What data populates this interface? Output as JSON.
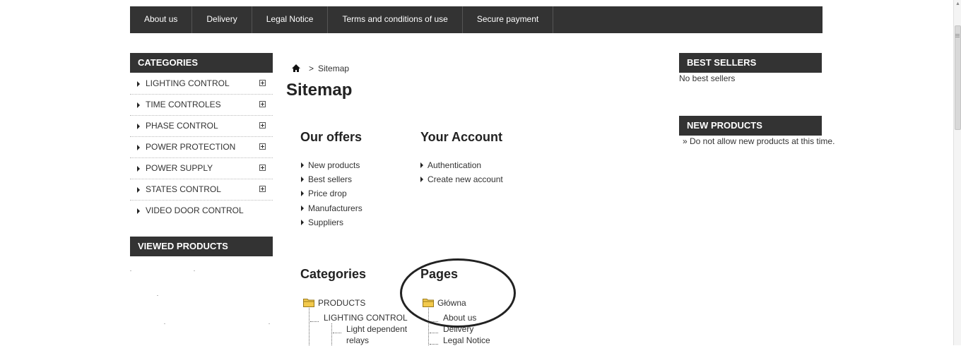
{
  "topnav": {
    "items": [
      "About us",
      "Delivery",
      "Legal Notice",
      "Terms and conditions of use",
      "Secure payment"
    ]
  },
  "left": {
    "categories_title": "CATEGORIES",
    "categories": [
      {
        "label": "LIGHTING CONTROL",
        "expandable": true
      },
      {
        "label": "TIME CONTROLES",
        "expandable": true
      },
      {
        "label": "PHASE CONTROL",
        "expandable": true
      },
      {
        "label": "POWER PROTECTION",
        "expandable": true
      },
      {
        "label": "POWER SUPPLY",
        "expandable": true
      },
      {
        "label": "STATES CONTROL",
        "expandable": true
      },
      {
        "label": "VIDEO DOOR CONTROL",
        "expandable": false
      }
    ],
    "viewed_title": "VIEWED PRODUCTS"
  },
  "breadcrumb": {
    "separator": ">",
    "current": "Sitemap"
  },
  "page_title": "Sitemap",
  "our_offers": {
    "title": "Our offers",
    "links": [
      "New products",
      "Best sellers",
      "Price drop",
      "Manufacturers",
      "Suppliers"
    ]
  },
  "your_account": {
    "title": "Your Account",
    "links": [
      "Authentication",
      "Create new account"
    ]
  },
  "categories_tree": {
    "title": "Categories",
    "root": "PRODUCTS",
    "child": "LIGHTING CONTROL",
    "grandchild_line1": "Light dependent",
    "grandchild_line2": "relays"
  },
  "pages_tree": {
    "title": "Pages",
    "root": "Główna",
    "children": [
      "About us",
      "Delivery",
      "Legal Notice"
    ]
  },
  "right": {
    "best_sellers_title": "BEST SELLERS",
    "best_sellers_text": "No best sellers",
    "new_products_title": "NEW PRODUCTS",
    "new_products_text": "» Do not allow new products at this time."
  },
  "colors": {
    "bar": "#333333",
    "folder": "#f2c94c"
  },
  "icons": [
    "home-icon",
    "folder-icon",
    "plus-icon",
    "triangle-bullet-icon"
  ]
}
